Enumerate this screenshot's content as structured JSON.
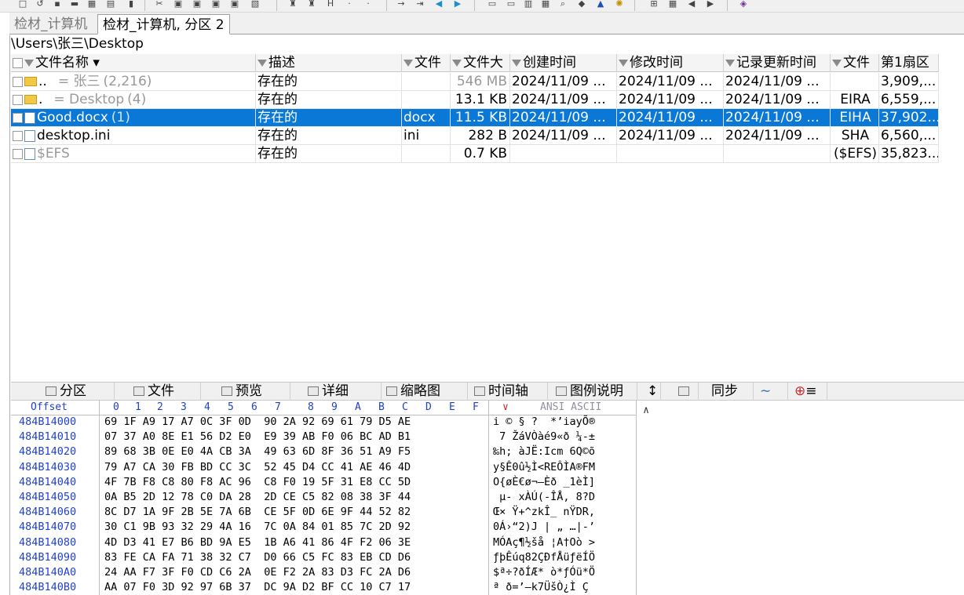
{
  "tabs": [
    {
      "label": "检材_计算机"
    },
    {
      "label": "检材_计算机, 分区 2"
    }
  ],
  "path": "\\Users\\张三\\Desktop",
  "file_list": {
    "columns": [
      "文件名称",
      "描述",
      "文件",
      "文件大",
      "创建时间",
      "修改时间",
      "记录更新时间",
      "文件",
      "第1扇区"
    ],
    "rows": [
      {
        "name": "..",
        "name_extra": "=   张三",
        "count": "(2,216)",
        "desc": "存在的",
        "ext": "",
        "size": "546 MB",
        "created": "2024/11/09  ...",
        "modified": "2024/11/09  ...",
        "record": "2024/11/09  ...",
        "attr": "",
        "sector": "3,909,...",
        "icon": "folder-icon",
        "muted": true,
        "selected": false
      },
      {
        "name": ".",
        "name_extra": "=   Desktop",
        "count": "(4)",
        "desc": "存在的",
        "ext": "",
        "size": "13.1 KB",
        "created": "2024/11/09  ...",
        "modified": "2024/11/09  ...",
        "record": "2024/11/09  ...",
        "attr": "EIRA",
        "sector": "6,559,...",
        "icon": "folder-icon",
        "muted": true,
        "selected": false
      },
      {
        "name": "Good.docx",
        "name_extra": "",
        "count": "(1)",
        "desc": "存在的",
        "ext": "docx",
        "size": "11.5 KB",
        "created": "2024/11/09  ...",
        "modified": "2024/11/09  ...",
        "record": "2024/11/09  ...",
        "attr": "EIHA",
        "sector": "37,902...",
        "icon": "document-icon",
        "muted": false,
        "selected": true
      },
      {
        "name": "desktop.ini",
        "name_extra": "",
        "count": "",
        "desc": "存在的",
        "ext": "ini",
        "size": "282 B",
        "created": "2024/11/09  ...",
        "modified": "2024/11/09  ...",
        "record": "2024/11/09  ...",
        "attr": "SHA",
        "sector": "6,560,...",
        "icon": "file-icon",
        "muted": false,
        "selected": false
      },
      {
        "name": "$EFS",
        "name_extra": "",
        "count": "",
        "desc": "存在的",
        "ext": "",
        "size": "0.7 KB",
        "created": "",
        "modified": "",
        "record": "",
        "attr": "($EFS)",
        "sector": "35,823...",
        "icon": "file-icon",
        "muted": true,
        "selected": false
      }
    ]
  },
  "bottom_tabs": [
    "分区",
    "文件",
    "预览",
    "详细",
    "缩略图",
    "时间轴",
    "图例说明",
    "同步"
  ],
  "hex": {
    "offset_label": "Offset",
    "col_labels": [
      "0",
      "1",
      "2",
      "3",
      "4",
      "5",
      "6",
      "7",
      "8",
      "9",
      "A",
      "B",
      "C",
      "D",
      "E",
      "F"
    ],
    "ansi_label": "ANSI ASCII",
    "rows": [
      {
        "off": "484B14000",
        "bytes": "69 1F A9 17 A7 0C 3F 0D  90 2A 92 69 61 79 D5 AE",
        "ascii": "i © § ?  *’iayÕ®"
      },
      {
        "off": "484B14010",
        "bytes": "07 37 A0 8E E1 56 D2 E0  E9 39 AB F0 06 BC AD B1",
        "ascii": " 7 ŽáVÒàé9«ð ¼-±"
      },
      {
        "off": "484B14020",
        "bytes": "89 68 3B 0E E0 4A CB 3A  49 63 6D 8F 36 51 A9 F5",
        "ascii": "‰h; àJË:Icm 6Q©õ"
      },
      {
        "off": "484B14030",
        "bytes": "79 A7 CA 30 FB BD CC 3C  52 45 D4 CC 41 AE 46 4D",
        "ascii": "y§Ê0û½Ì<REÔÌA®FM"
      },
      {
        "off": "484B14040",
        "bytes": "4F 7B F8 C8 80 F8 AC 96  C8 F0 19 5F 31 E8 CC 5D",
        "ascii": "O{øÈ€ø¬–Èð _1èÌ]"
      },
      {
        "off": "484B14050",
        "bytes": "0A B5 2D 12 78 C0 DA 28  2D CE C5 82 08 38 3F 44",
        "ascii": " µ- xÀÚ(-ÎÅ‚ 8?D"
      },
      {
        "off": "484B14060",
        "bytes": "8C D7 1A 9F 2B 5E 7A 6B  CE 5F 0D 6E 9F 44 52 82",
        "ascii": "Œ× Ÿ+^zkÎ_ nŸDR‚"
      },
      {
        "off": "484B14070",
        "bytes": "30 C1 9B 93 32 29 4A 16  7C 0A 84 01 85 7C 2D 92",
        "ascii": "0Á›“2)J | „ …|-’"
      },
      {
        "off": "484B14080",
        "bytes": "4D D3 41 E7 B6 BD 9A E5  1B A6 41 86 4F F2 06 3E",
        "ascii": "MÓAç¶½šå ¦A†Oò >"
      },
      {
        "off": "484B14090",
        "bytes": "83 FE CA FA 71 38 32 C7  D0 66 C5 FC 83 EB CD D6",
        "ascii": "ƒþÊúq82ÇÐfÅüƒëÍÖ"
      },
      {
        "off": "484B140A0",
        "bytes": "24 AA F7 3F F0 CD C6 2A  0E F2 2A 83 D3 FC 2A D6",
        "ascii": "$ª÷?ðÍÆ* ò*ƒÓü*Ö"
      },
      {
        "off": "484B140B0",
        "bytes": "AA 07 F0 3D 92 97 6B 37  DC 9A D2 BF CC 10 C7 17",
        "ascii": "ª ð=’—k7ÜšÒ¿Ì Ç "
      }
    ]
  }
}
